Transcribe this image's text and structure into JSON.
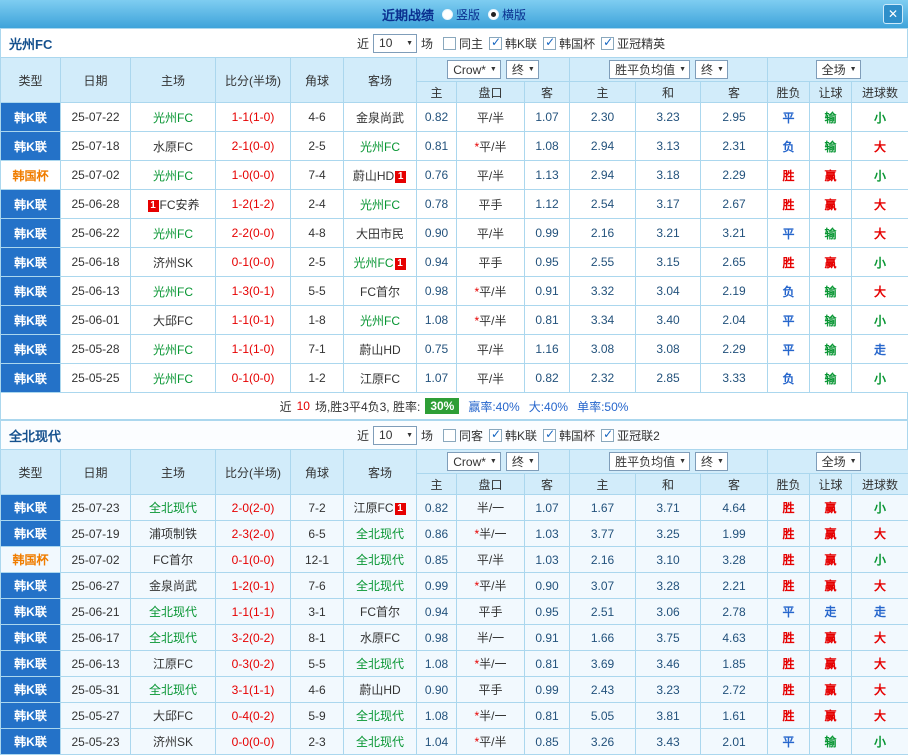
{
  "titlebar": {
    "title": "近期战绩",
    "options": [
      {
        "label": "竖版",
        "selected": false
      },
      {
        "label": "横版",
        "selected": true
      }
    ],
    "close_label": "✕"
  },
  "columns": {
    "type": "类型",
    "date": "日期",
    "home": "主场",
    "score": "比分(半场)",
    "corner": "角球",
    "away": "客场",
    "asian_dd": "Crow*",
    "asian_final_dd": "终",
    "asian_home": "主",
    "asian_line": "盘口",
    "asian_away": "客",
    "euro_dd": "胜平负均值",
    "euro_final_dd": "终",
    "euro_home": "主",
    "euro_draw": "和",
    "euro_away": "客",
    "scope_dd": "全场",
    "result": "胜负",
    "handicap": "让球",
    "goals": "进球数"
  },
  "colors": {
    "accent_blue": "#2472c8",
    "win_red": "#e60000",
    "lose_green": "#089633",
    "draw_blue": "#2666cc",
    "odds_navy": "#23527c",
    "badge_green": "#2e9e36"
  },
  "sections": [
    {
      "team": "光州FC",
      "filters": {
        "near": "近",
        "count": "10",
        "games": "场",
        "checks": [
          {
            "label": "同主",
            "checked": false
          },
          {
            "label": "韩K联",
            "checked": true
          },
          {
            "label": "韩国杯",
            "checked": true
          },
          {
            "label": "亚冠精英",
            "checked": true
          }
        ]
      },
      "rows": [
        {
          "type": "韩K联",
          "date": "25-07-22",
          "home": "光州FC",
          "score": "1-1(1-0)",
          "corner": "4-6",
          "away": "金泉尚武",
          "h": "0.82",
          "line": "平/半",
          "a": "1.07",
          "eh": "2.30",
          "ed": "3.23",
          "ea": "2.95",
          "res": "平",
          "han": "输",
          "goal": "小"
        },
        {
          "type": "韩K联",
          "date": "25-07-18",
          "home": "水原FC",
          "score": "2-1(0-0)",
          "corner": "2-5",
          "away": "光州FC",
          "h": "0.81",
          "line": "*平/半",
          "a": "1.08",
          "eh": "2.94",
          "ed": "3.13",
          "ea": "2.31",
          "res": "负",
          "han": "输",
          "goal": "大"
        },
        {
          "type": "韩国杯",
          "date": "25-07-02",
          "home": "光州FC",
          "score": "1-0(0-0)",
          "corner": "7-4",
          "away": {
            "name": "蔚山HD",
            "card": "1"
          },
          "h": "0.76",
          "line": "平/半",
          "a": "1.13",
          "eh": "2.94",
          "ed": "3.18",
          "ea": "2.29",
          "res": "胜",
          "han": "赢",
          "goal": "小"
        },
        {
          "type": "韩K联",
          "date": "25-06-28",
          "home": {
            "name": "FC安养",
            "card": "1",
            "pos": "before"
          },
          "score": "1-2(1-2)",
          "corner": "2-4",
          "away": "光州FC",
          "h": "0.78",
          "line": "平手",
          "a": "1.12",
          "eh": "2.54",
          "ed": "3.17",
          "ea": "2.67",
          "res": "胜",
          "han": "赢",
          "goal": "大"
        },
        {
          "type": "韩K联",
          "date": "25-06-22",
          "home": "光州FC",
          "score": "2-2(0-0)",
          "corner": "4-8",
          "away": "大田市民",
          "h": "0.90",
          "line": "平/半",
          "a": "0.99",
          "eh": "2.16",
          "ed": "3.21",
          "ea": "3.21",
          "res": "平",
          "han": "输",
          "goal": "大"
        },
        {
          "type": "韩K联",
          "date": "25-06-18",
          "home": "济州SK",
          "score": "0-1(0-0)",
          "corner": "2-5",
          "away": {
            "name": "光州FC",
            "card": "1"
          },
          "h": "0.94",
          "line": "平手",
          "a": "0.95",
          "eh": "2.55",
          "ed": "3.15",
          "ea": "2.65",
          "res": "胜",
          "han": "赢",
          "goal": "小"
        },
        {
          "type": "韩K联",
          "date": "25-06-13",
          "home": "光州FC",
          "score": "1-3(0-1)",
          "corner": "5-5",
          "away": "FC首尔",
          "h": "0.98",
          "line": "*平/半",
          "a": "0.91",
          "eh": "3.32",
          "ed": "3.04",
          "ea": "2.19",
          "res": "负",
          "han": "输",
          "goal": "大"
        },
        {
          "type": "韩K联",
          "date": "25-06-01",
          "home": "大邱FC",
          "score": "1-1(0-1)",
          "corner": "1-8",
          "away": "光州FC",
          "h": "1.08",
          "line": "*平/半",
          "a": "0.81",
          "eh": "3.34",
          "ed": "3.40",
          "ea": "2.04",
          "res": "平",
          "han": "输",
          "goal": "小"
        },
        {
          "type": "韩K联",
          "date": "25-05-28",
          "home": "光州FC",
          "score": "1-1(1-0)",
          "corner": "7-1",
          "away": "蔚山HD",
          "h": "0.75",
          "line": "平/半",
          "a": "1.16",
          "eh": "3.08",
          "ed": "3.08",
          "ea": "2.29",
          "res": "平",
          "han": "输",
          "goal": "走"
        },
        {
          "type": "韩K联",
          "date": "25-05-25",
          "home": "光州FC",
          "score": "0-1(0-0)",
          "corner": "1-2",
          "away": "江原FC",
          "h": "1.07",
          "line": "平/半",
          "a": "0.82",
          "eh": "2.32",
          "ed": "2.85",
          "ea": "3.33",
          "res": "负",
          "han": "输",
          "goal": "小"
        }
      ],
      "summary": {
        "near": "近",
        "count": "10",
        "text": "场,胜3平4负3, 胜率:",
        "badge": "30%",
        "stats": [
          "赢率:40%",
          "大:40%",
          "单率:50%"
        ]
      }
    },
    {
      "team": "全北现代",
      "filters": {
        "near": "近",
        "count": "10",
        "games": "场",
        "checks": [
          {
            "label": "同客",
            "checked": false
          },
          {
            "label": "韩K联",
            "checked": true
          },
          {
            "label": "韩国杯",
            "checked": true
          },
          {
            "label": "亚冠联2",
            "checked": true
          }
        ]
      },
      "rows": [
        {
          "type": "韩K联",
          "date": "25-07-23",
          "home": "全北现代",
          "score": "2-0(2-0)",
          "corner": "7-2",
          "away": {
            "name": "江原FC",
            "card": "1"
          },
          "h": "0.82",
          "line": "半/一",
          "a": "1.07",
          "eh": "1.67",
          "ed": "3.71",
          "ea": "4.64",
          "res": "胜",
          "han": "赢",
          "goal": "小"
        },
        {
          "type": "韩K联",
          "date": "25-07-19",
          "home": "浦项制铁",
          "score": "2-3(2-0)",
          "corner": "6-5",
          "away": "全北现代",
          "h": "0.86",
          "line": "*半/一",
          "a": "1.03",
          "eh": "3.77",
          "ed": "3.25",
          "ea": "1.99",
          "res": "胜",
          "han": "赢",
          "goal": "大"
        },
        {
          "type": "韩国杯",
          "date": "25-07-02",
          "home": "FC首尔",
          "score": "0-1(0-0)",
          "corner": "12-1",
          "away": "全北现代",
          "h": "0.85",
          "line": "平/半",
          "a": "1.03",
          "eh": "2.16",
          "ed": "3.10",
          "ea": "3.28",
          "res": "胜",
          "han": "赢",
          "goal": "小"
        },
        {
          "type": "韩K联",
          "date": "25-06-27",
          "home": "金泉尚武",
          "score": "1-2(0-1)",
          "corner": "7-6",
          "away": "全北现代",
          "h": "0.99",
          "line": "*平/半",
          "a": "0.90",
          "eh": "3.07",
          "ed": "3.28",
          "ea": "2.21",
          "res": "胜",
          "han": "赢",
          "goal": "大"
        },
        {
          "type": "韩K联",
          "date": "25-06-21",
          "home": "全北现代",
          "score": "1-1(1-1)",
          "corner": "3-1",
          "away": "FC首尔",
          "h": "0.94",
          "line": "平手",
          "a": "0.95",
          "eh": "2.51",
          "ed": "3.06",
          "ea": "2.78",
          "res": "平",
          "han": "走",
          "goal": "走"
        },
        {
          "type": "韩K联",
          "date": "25-06-17",
          "home": "全北现代",
          "score": "3-2(0-2)",
          "corner": "8-1",
          "away": "水原FC",
          "h": "0.98",
          "line": "半/一",
          "a": "0.91",
          "eh": "1.66",
          "ed": "3.75",
          "ea": "4.63",
          "res": "胜",
          "han": "赢",
          "goal": "大"
        },
        {
          "type": "韩K联",
          "date": "25-06-13",
          "home": "江原FC",
          "score": "0-3(0-2)",
          "corner": "5-5",
          "away": "全北现代",
          "h": "1.08",
          "line": "*半/一",
          "a": "0.81",
          "eh": "3.69",
          "ed": "3.46",
          "ea": "1.85",
          "res": "胜",
          "han": "赢",
          "goal": "大"
        },
        {
          "type": "韩K联",
          "date": "25-05-31",
          "home": "全北现代",
          "score": "3-1(1-1)",
          "corner": "4-6",
          "away": "蔚山HD",
          "h": "0.90",
          "line": "平手",
          "a": "0.99",
          "eh": "2.43",
          "ed": "3.23",
          "ea": "2.72",
          "res": "胜",
          "han": "赢",
          "goal": "大"
        },
        {
          "type": "韩K联",
          "date": "25-05-27",
          "home": "大邱FC",
          "score": "0-4(0-2)",
          "corner": "5-9",
          "away": "全北现代",
          "h": "1.08",
          "line": "*半/一",
          "a": "0.81",
          "eh": "5.05",
          "ed": "3.81",
          "ea": "1.61",
          "res": "胜",
          "han": "赢",
          "goal": "大"
        },
        {
          "type": "韩K联",
          "date": "25-05-23",
          "home": "济州SK",
          "score": "0-0(0-0)",
          "corner": "2-3",
          "away": "全北现代",
          "h": "1.04",
          "line": "*平/半",
          "a": "0.85",
          "eh": "3.26",
          "ed": "3.43",
          "ea": "2.01",
          "res": "平",
          "han": "输",
          "goal": "小"
        }
      ]
    }
  ]
}
